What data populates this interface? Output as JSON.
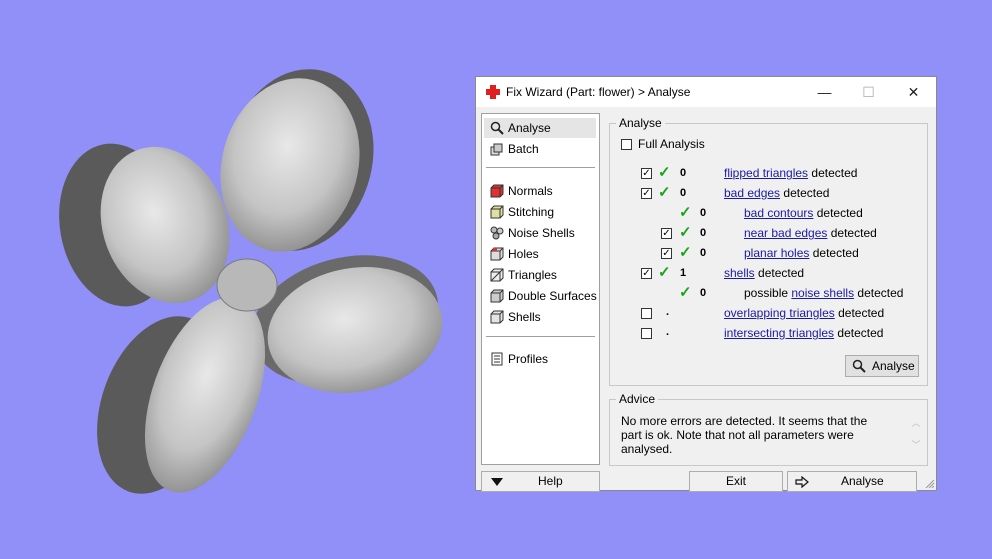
{
  "viewport": {
    "background": "#9090f8",
    "part_name": "flower"
  },
  "window": {
    "title": "Fix Wizard (Part: flower) > Analyse",
    "minimize": "—",
    "maximize": "☐",
    "close": "✕"
  },
  "sidebar": {
    "items": [
      {
        "label": "Analyse",
        "icon": "magnifier-icon"
      },
      {
        "label": "Batch",
        "icon": "batch-icon"
      },
      {
        "label": "Normals",
        "icon": "normals-cube-icon"
      },
      {
        "label": "Stitching",
        "icon": "stitching-cube-icon"
      },
      {
        "label": "Noise Shells",
        "icon": "noise-shells-icon"
      },
      {
        "label": "Holes",
        "icon": "holes-cube-icon"
      },
      {
        "label": "Triangles",
        "icon": "triangles-cube-icon"
      },
      {
        "label": "Double Surfaces",
        "icon": "double-surfaces-icon"
      },
      {
        "label": "Shells",
        "icon": "shells-cube-icon"
      },
      {
        "label": "Profiles",
        "icon": "profiles-icon"
      }
    ],
    "help_label": "Help"
  },
  "analyse_group": {
    "title": "Analyse",
    "full_analysis_label": "Full Analysis",
    "detected_word": "detected",
    "rows": [
      {
        "count": "0",
        "link": "flipped triangles",
        "prefix": "",
        "checked": true
      },
      {
        "count": "0",
        "link": "bad edges",
        "prefix": "",
        "checked": true
      },
      {
        "count": "0",
        "link": "bad contours",
        "prefix": "",
        "checked": false
      },
      {
        "count": "0",
        "link": "near bad edges",
        "prefix": "",
        "checked": true
      },
      {
        "count": "0",
        "link": "planar holes",
        "prefix": "",
        "checked": true
      },
      {
        "count": "1",
        "link": "shells",
        "prefix": "",
        "checked": true
      },
      {
        "count": "0",
        "link": "noise shells",
        "prefix": "possible",
        "checked": false
      },
      {
        "count": ".",
        "link": "overlapping triangles",
        "prefix": "",
        "checked": false
      },
      {
        "count": ".",
        "link": "intersecting triangles",
        "prefix": "",
        "checked": false
      }
    ],
    "analyse_button": "Analyse"
  },
  "advice_group": {
    "title": "Advice",
    "text": "No more errors are detected. It seems that the part is ok. Note that not all parameters were analysed."
  },
  "footer": {
    "exit_label": "Exit",
    "analyse_label": "Analyse"
  },
  "colors": {
    "link": "#1a1aa6",
    "check": "#1aa31a",
    "brand_cross": "#e02020"
  }
}
